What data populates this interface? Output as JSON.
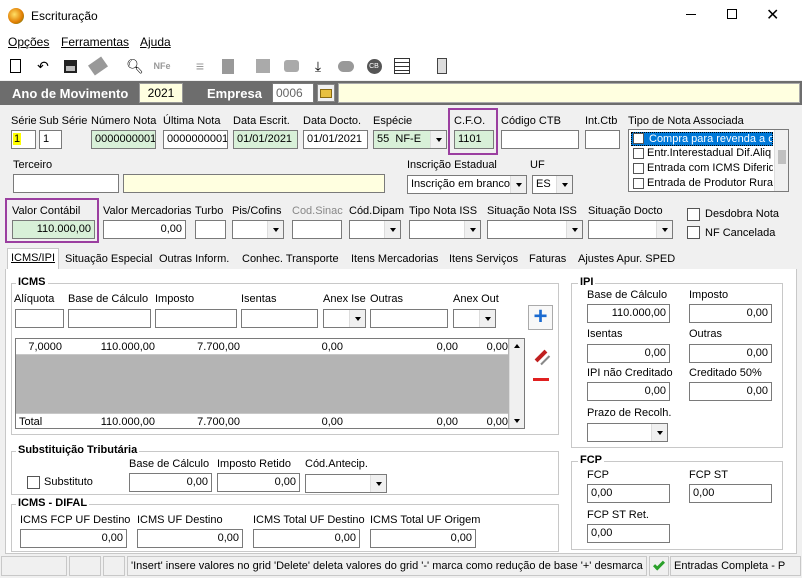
{
  "window": {
    "title": "Escrituração"
  },
  "menu": [
    "Opções",
    "Ferramentas",
    "Ajuda"
  ],
  "toolbar_icons": [
    "new-icon",
    "undo-icon",
    "save-icon",
    "delete-icon",
    "preview-icon",
    "nfe-icon",
    "list-icon",
    "calc-icon",
    "building-icon",
    "cart-icon",
    "export-icon",
    "cloud-icon",
    "cb-icon",
    "table-icon",
    "exit-icon"
  ],
  "header": {
    "ano_label": "Ano de Movimento",
    "ano_value": "2021",
    "empresa_label": "Empresa",
    "empresa_value": "0006"
  },
  "fields": {
    "serie_label": "Série",
    "serie_value": "1",
    "subserie_label": "Sub Série",
    "subserie_value": "1",
    "numero_nota_label": "Número Nota",
    "numero_nota_value": "0000000001",
    "ultima_nota_label": "Última Nota",
    "ultima_nota_value": "0000000001",
    "data_escrit_label": "Data Escrit.",
    "data_escrit_value": "01/01/2021",
    "data_docto_label": "Data Docto.",
    "data_docto_value": "01/01/2021",
    "especie_label": "Espécie",
    "especie_code": "55",
    "especie_value": "NF-E",
    "cfo_label": "C.F.O.",
    "cfo_value": "1101",
    "codigo_ctb_label": "Código CTB",
    "int_ctb_label": "Int.Ctb",
    "tipo_nota_label": "Tipo de Nota Associada",
    "tipo_nota_options": [
      "Compra para revenda a co",
      "Entr.Interestadual Dif.Aliq",
      "Entrada com ICMS Diferido",
      "Entrada de Produtor Rural"
    ],
    "terceiro_label": "Terceiro",
    "inscricao_label": "Inscrição Estadual",
    "inscricao_value": "Inscrição em branco",
    "uf_label": "UF",
    "uf_value": "ES",
    "valor_contabil_label": "Valor Contábil",
    "valor_contabil_value": "110.000,00",
    "valor_merc_label": "Valor Mercadorias",
    "valor_merc_value": "0,00",
    "turbo_label": "Turbo",
    "pis_label": "Pis/Cofins",
    "cod_sinac_label": "Cod.Sinac",
    "cod_dipam_label": "Cód.Dipam",
    "tipo_iss_label": "Tipo Nota ISS",
    "sit_iss_label": "Situação Nota ISS",
    "sit_docto_label": "Situação Docto",
    "desdobra_label": "Desdobra Nota",
    "nf_cancelada_label": "NF Cancelada"
  },
  "tabs": [
    "ICMS/IPI",
    "Situação Especial",
    "Outras Inform.",
    "Conhec. Transporte",
    "Itens Mercadorias",
    "Itens Serviços",
    "Faturas",
    "Ajustes Apur. SPED"
  ],
  "icms": {
    "title": "ICMS",
    "cols": [
      "Alíquota",
      "Base de Cálculo",
      "Imposto",
      "Isentas",
      "Anex Ise",
      "Outras",
      "Anex Out"
    ],
    "row": [
      "7,0000",
      "110.000,00",
      "7.700,00",
      "0,00",
      "0,00",
      "0,00"
    ],
    "total_label": "Total",
    "total": [
      "110.000,00",
      "7.700,00",
      "0,00",
      "0,00",
      "0,00"
    ]
  },
  "st": {
    "title": "Substituição Tributária",
    "substituto_label": "Substituto",
    "base_label": "Base de Cálculo",
    "base_value": "0,00",
    "imposto_label": "Imposto Retido",
    "imposto_value": "0,00",
    "cod_label": "Cód.Antecip."
  },
  "difal": {
    "title": "ICMS - DIFAL",
    "f1_label": "ICMS FCP UF Destino",
    "f1_value": "0,00",
    "f2_label": "ICMS UF Destino",
    "f2_value": "0,00",
    "f3_label": "ICMS Total UF Destino",
    "f3_value": "0,00",
    "f4_label": "ICMS Total UF Origem",
    "f4_value": "0,00"
  },
  "ipi": {
    "title": "IPI",
    "base_label": "Base de Cálculo",
    "base_value": "110.000,00",
    "imposto_label": "Imposto",
    "imposto_value": "0,00",
    "isentas_label": "Isentas",
    "isentas_value": "0,00",
    "outras_label": "Outras",
    "outras_value": "0,00",
    "ipi_nc_label": "IPI não Creditado",
    "ipi_nc_value": "0,00",
    "cred50_label": "Creditado 50%",
    "cred50_value": "0,00",
    "prazo_label": "Prazo de Recolh."
  },
  "fcp": {
    "title": "FCP",
    "fcp_label": "FCP",
    "fcp_value": "0,00",
    "fcpst_label": "FCP ST",
    "fcpst_value": "0,00",
    "fcpstret_label": "FCP ST Ret.",
    "fcpstret_value": "0,00"
  },
  "status": {
    "hint": "'Insert' insere valores no grid 'Delete' deleta valores do grid '-' marca como redução de base '+' desmarca re",
    "mode": "Entradas Completa - P"
  },
  "colors": {
    "accent": "#9b3fa0",
    "green_field": "#d8f0d8",
    "header_bg": "#6d6d6d"
  }
}
